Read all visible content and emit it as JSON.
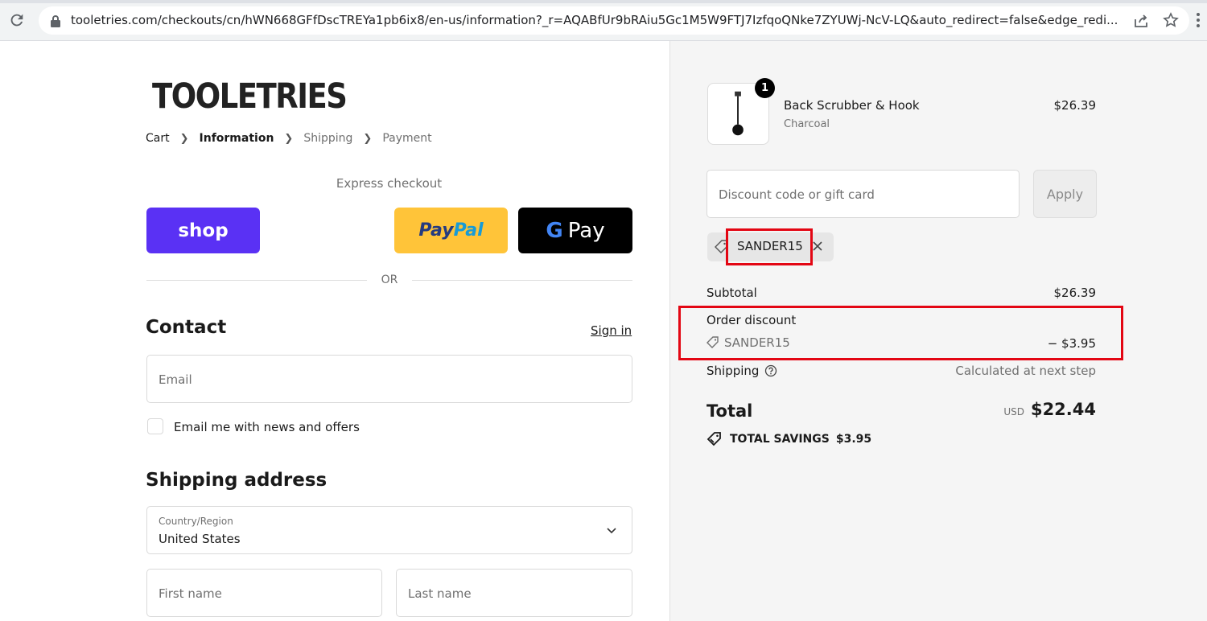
{
  "browser": {
    "url": "tooletries.com/checkouts/cn/hWN668GFfDscTREYa1pb6ix8/en-us/information?_r=AQABfUr9bRAiu5Gc1M5W9FTJ7IzfqoQNke7ZYUWj-NcV-LQ&auto_redirect=false&edge_redi..."
  },
  "brand": {
    "name": "TOOLETRIES"
  },
  "breadcrumb": [
    "Cart",
    "Information",
    "Shipping",
    "Payment"
  ],
  "express": {
    "label": "Express checkout",
    "shop_label": "shop",
    "paypal_label_1": "Pay",
    "paypal_label_2": "Pal",
    "gpay_g": "G",
    "gpay_label": "Pay",
    "or_label": "OR"
  },
  "contact": {
    "heading": "Contact",
    "sign_in": "Sign in",
    "email_placeholder": "Email",
    "newsletter_label": "Email me with news and offers"
  },
  "shipping_address": {
    "heading": "Shipping address",
    "country_label": "Country/Region",
    "country_value": "United States",
    "first_name_placeholder": "First name",
    "last_name_placeholder": "Last name"
  },
  "summary": {
    "product": {
      "name": "Back Scrubber & Hook",
      "variant": "Charcoal",
      "price": "$26.39",
      "quantity": "1"
    },
    "discount_placeholder": "Discount code or gift card",
    "apply_label": "Apply",
    "applied_code": "SANDER15",
    "subtotal_label": "Subtotal",
    "subtotal_value": "$26.39",
    "order_discount_label": "Order discount",
    "order_discount_code": "SANDER15",
    "order_discount_value": "− $3.95",
    "shipping_label": "Shipping",
    "shipping_value": "Calculated at next step",
    "total_label": "Total",
    "total_currency": "USD",
    "total_value": "$22.44",
    "savings_label": "TOTAL SAVINGS",
    "savings_value": "$3.95"
  },
  "colors": {
    "shop": "#5a31f4",
    "paypal": "#ffc439",
    "gpay": "#000000",
    "highlight": "#e30613"
  }
}
